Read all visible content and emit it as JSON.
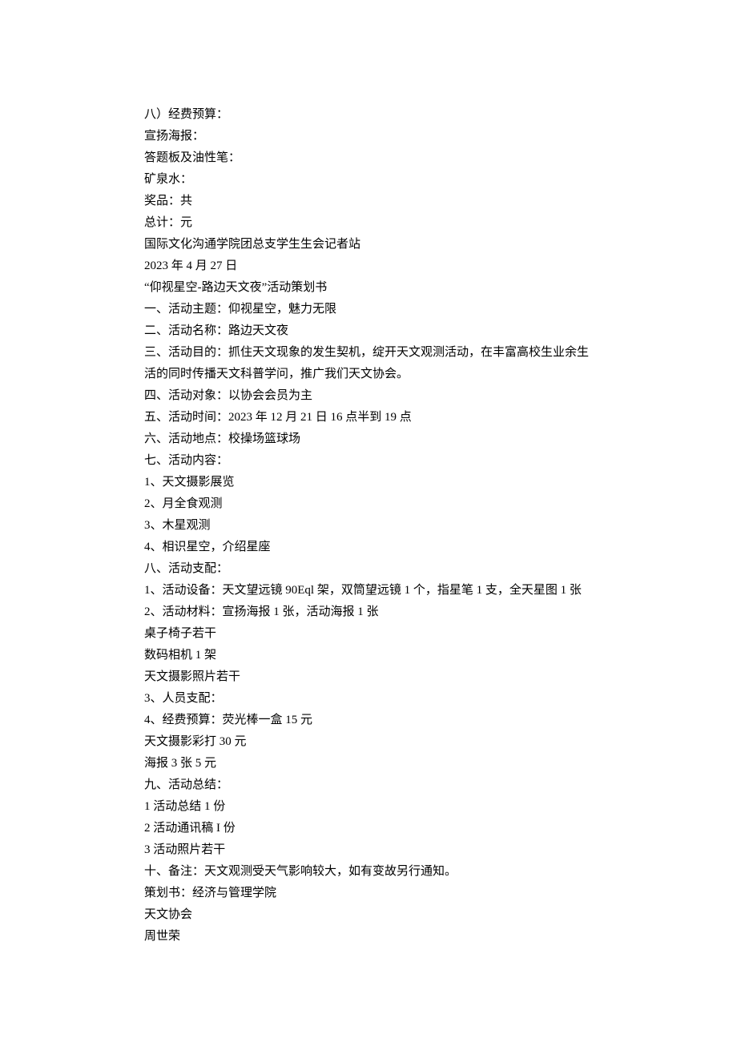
{
  "lines": [
    "八）经费预算：",
    "宣扬海报：",
    "答题板及油性笔：",
    "矿泉水：",
    "奖品：共",
    "总计：元",
    "国际文化沟通学院团总支学生生会记者站",
    "2023 年 4 月 27 日",
    "“仰视星空-路边天文夜”活动策划书",
    "一、活动主题：仰视星空，魅力无限",
    "二、活动名称：路边天文夜",
    "三、活动目的：抓住天文现象的发生契机，绽开天文观测活动，在丰富高校生业余生活的同时传播天文科普学问，推广我们天文协会。",
    "四、活动对象：以协会会员为主",
    "五、活动时间：2023 年 12 月 21 日 16 点半到 19 点",
    "六、活动地点：校操场篮球场",
    "七、活动内容：",
    "1、天文摄影展览",
    "2、月全食观测",
    "3、木星观测",
    "4、相识星空，介绍星座",
    "八、活动支配：",
    "1、活动设备：天文望远镜 90Eql 架，双筒望远镜 1 个，指星笔 1 支，全天星图 1 张",
    "2、活动材料：宣扬海报 1 张，活动海报 1 张",
    "桌子椅子若干",
    "数码相机 1 架",
    "天文摄影照片若干",
    "3、人员支配：",
    "4、经费预算：荧光棒一盒 15 元",
    "天文摄影彩打 30 元",
    "海报 3 张 5 元",
    "九、活动总结：",
    "1 活动总结 1 份",
    "2 活动通讯稿 I 份",
    "3 活动照片若干",
    "十、备注：天文观测受天气影响较大，如有变故另行通知。",
    "策划书：经济与管理学院",
    "天文协会",
    "周世荣"
  ]
}
